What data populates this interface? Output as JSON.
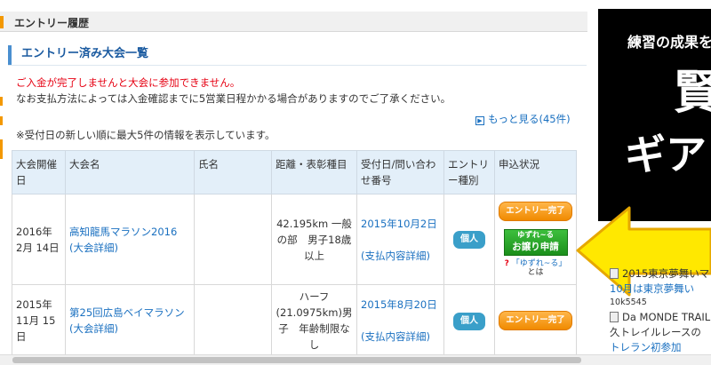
{
  "header": {
    "title": "エントリー履歴"
  },
  "section": {
    "title": "エントリー済み大会一覧"
  },
  "messages": {
    "warning": "ご入金が完了しませんと大会に参加できません。",
    "note": "なお支払方法によっては入金確認までに5営業日程かかる場合がありますのでご了承ください。",
    "info": "※受付日の新しい順に最大5件の情報を表示しています。"
  },
  "more_link": {
    "label": "もっと見る(45件)"
  },
  "table": {
    "headers": [
      "大会開催日",
      "大会名",
      "氏名",
      "距離・表彰種目",
      "受付日/問い合わせ番号",
      "エントリー種別",
      "申込状況"
    ],
    "rows": [
      {
        "date": "2016年 2月 14日",
        "race": "高知龍馬マラソン2016",
        "race_detail": "(大会詳細)",
        "name": "",
        "distance": "42.195km 一般の部　男子18歳以上",
        "received": "2015年10月2日",
        "payment_detail": "(支払内容詳細)",
        "entry_type": "個人",
        "status": "エントリー完了",
        "transfer_line1": "ゆずれ~る",
        "transfer_line2": "お譲り申請",
        "help_mark": "?",
        "help_text": "「ゆずれ~る」",
        "help_text2": "とは"
      },
      {
        "date": "2015年 11月 15日",
        "race": "第25回広島ベイマラソン",
        "race_detail": "(大会詳細)",
        "name": "",
        "distance": "ハーフ(21.0975km)男子　年齢制限なし",
        "received": "2015年8月20日",
        "payment_detail": "(支払内容詳細)",
        "entry_type": "個人",
        "status": "エントリー完了"
      }
    ]
  },
  "banner": {
    "line1": "練習の成果を",
    "line2": "賢",
    "line3": "ギア"
  },
  "news": [
    {
      "title": "2015東京夢舞いマ",
      "link": "10月は東京夢舞い",
      "sub": "10k5545"
    },
    {
      "title": "Da MONDE TRAIL",
      "line2": "久トレイルレースの",
      "link": "トレラン初参加"
    }
  ],
  "colors": {
    "accent": "#f39800",
    "link": "#1a70c0",
    "warning": "#e60012",
    "table_header": "#e3eff9"
  }
}
